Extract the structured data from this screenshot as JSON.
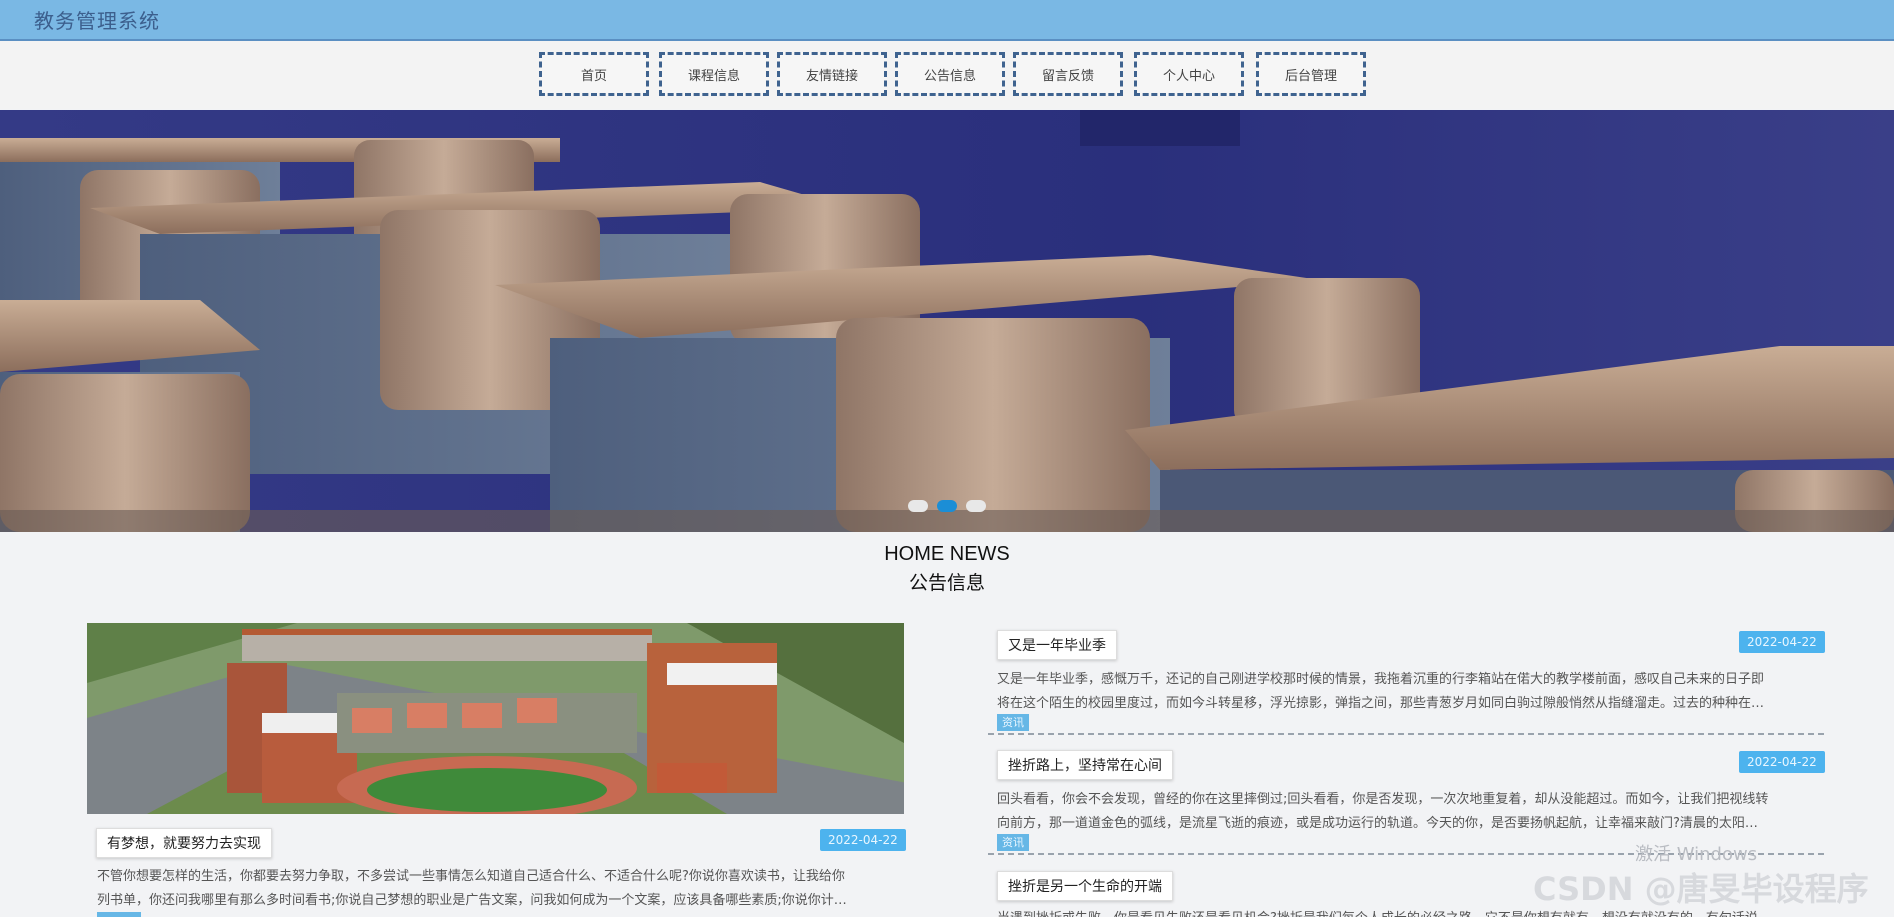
{
  "header": {
    "title": "教务管理系统"
  },
  "nav": {
    "items": [
      {
        "label": "首页"
      },
      {
        "label": "课程信息"
      },
      {
        "label": "友情链接"
      },
      {
        "label": "公告信息"
      },
      {
        "label": "留言反馈"
      },
      {
        "label": "个人中心"
      },
      {
        "label": "后台管理"
      }
    ]
  },
  "banner": {
    "slide_count": 3,
    "active_index": 1
  },
  "news_section": {
    "title_en": "HOME NEWS",
    "title_cn": "公告信息",
    "featured": {
      "title": "有梦想，就要努力去实现",
      "date": "2022-04-22",
      "line1": "不管你想要怎样的生活，你都要去努力争取，不多尝试一些事情怎么知道自己适合什么、不适合什么呢?你说你喜欢读书，让我给你",
      "line2": "列书单，你还问我哪里有那么多时间看书;你说自己梦想的职业是广告文案，问我如何成为一个文案，应该具备哪些素质;你说你计…"
    },
    "items": [
      {
        "title": "又是一年毕业季",
        "date": "2022-04-22",
        "line1": "又是一年毕业季，感慨万千，还记的自己刚进学校那时候的情景，我拖着沉重的行李箱站在偌大的教学楼前面，感叹自己未来的日子即",
        "line2": "将在这个陌生的校园里度过，而如今斗转星移，浮光掠影，弹指之间，那些青葱岁月如同白驹过隙般悄然从指缝溜走。过去的种种在…",
        "tag": "资讯"
      },
      {
        "title": "挫折路上，坚持常在心间",
        "date": "2022-04-22",
        "line1": "回头看看，你会不会发现，曾经的你在这里摔倒过;回头看看，你是否发现，一次次地重复着，却从没能超过。而如今，让我们把视线转",
        "line2": "向前方，那一道道金色的弧线，是流星飞逝的痕迹，或是成功运行的轨道。今天的你，是否要扬帆起航，让幸福来敲门?清晨的太阳…",
        "tag": "资讯"
      },
      {
        "title": "挫折是另一个生命的开端",
        "line1": "当遇到挫折或失败，你是看见失败还是看见机会?挫折是我们每个人成长的必经之路，它不是你想有就有，想没有就没有的。有句话说"
      }
    ]
  },
  "watermark": {
    "activation": "激活 Windows",
    "csdn": "CSDN @唐旻毕设程序"
  }
}
